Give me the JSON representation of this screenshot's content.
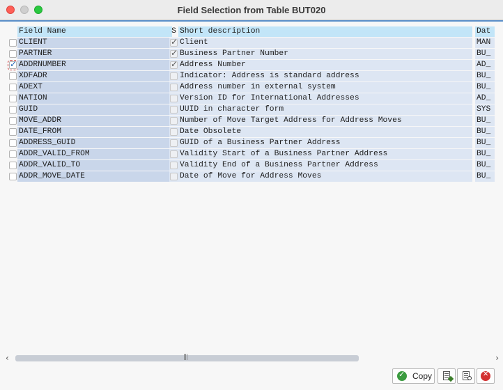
{
  "window": {
    "title": "Field Selection from Table BUT020"
  },
  "columns": {
    "field_name": "Field Name",
    "s": "S",
    "short_description": "Short description",
    "dat": "Dat"
  },
  "rows": [
    {
      "selected": false,
      "focus": false,
      "name": "CLIENT",
      "s": true,
      "desc": "Client",
      "dat": "MAN"
    },
    {
      "selected": false,
      "focus": false,
      "name": "PARTNER",
      "s": true,
      "desc": "Business Partner Number",
      "dat": "BU_"
    },
    {
      "selected": true,
      "focus": true,
      "name": "ADDRNUMBER",
      "s": true,
      "desc": "Address Number",
      "dat": "AD_"
    },
    {
      "selected": false,
      "focus": false,
      "name": "XDFADR",
      "s": false,
      "desc": "Indicator: Address is standard address",
      "dat": "BU_"
    },
    {
      "selected": false,
      "focus": false,
      "name": "ADEXT",
      "s": false,
      "desc": "Address number in external system",
      "dat": "BU_"
    },
    {
      "selected": false,
      "focus": false,
      "name": "NATION",
      "s": false,
      "desc": "Version ID for International Addresses",
      "dat": "AD_"
    },
    {
      "selected": false,
      "focus": false,
      "name": "GUID",
      "s": false,
      "desc": "UUID in character form",
      "dat": "SYS"
    },
    {
      "selected": false,
      "focus": false,
      "name": "MOVE_ADDR",
      "s": false,
      "desc": "Number of Move Target Address for Address Moves",
      "dat": "BU_"
    },
    {
      "selected": false,
      "focus": false,
      "name": "DATE_FROM",
      "s": false,
      "desc": "Date Obsolete",
      "dat": "BU_"
    },
    {
      "selected": false,
      "focus": false,
      "name": "ADDRESS_GUID",
      "s": false,
      "desc": "GUID of a Business Partner Address",
      "dat": "BU_"
    },
    {
      "selected": false,
      "focus": false,
      "name": "ADDR_VALID_FROM",
      "s": false,
      "desc": "Validity Start of a Business Partner Address",
      "dat": "BU_"
    },
    {
      "selected": false,
      "focus": false,
      "name": "ADDR_VALID_TO",
      "s": false,
      "desc": "Validity End of a Business Partner Address",
      "dat": "BU_"
    },
    {
      "selected": false,
      "focus": false,
      "name": "ADDR_MOVE_DATE",
      "s": false,
      "desc": "Date of Move for Address Moves",
      "dat": "BU_"
    }
  ],
  "footer": {
    "copy_label": "Copy"
  },
  "icons": {
    "copy": "checkmark-icon",
    "btn_a": "document-edit-icon",
    "btn_b": "document-search-icon",
    "btn_x": "cancel-icon"
  },
  "colors": {
    "header": "#c2e5f8",
    "name_col": "#c9d6ea",
    "desc_col": "#dde6f3",
    "accent": "#5b8fc9",
    "ok": "#3b9b3f",
    "cancel": "#d32f2f"
  }
}
